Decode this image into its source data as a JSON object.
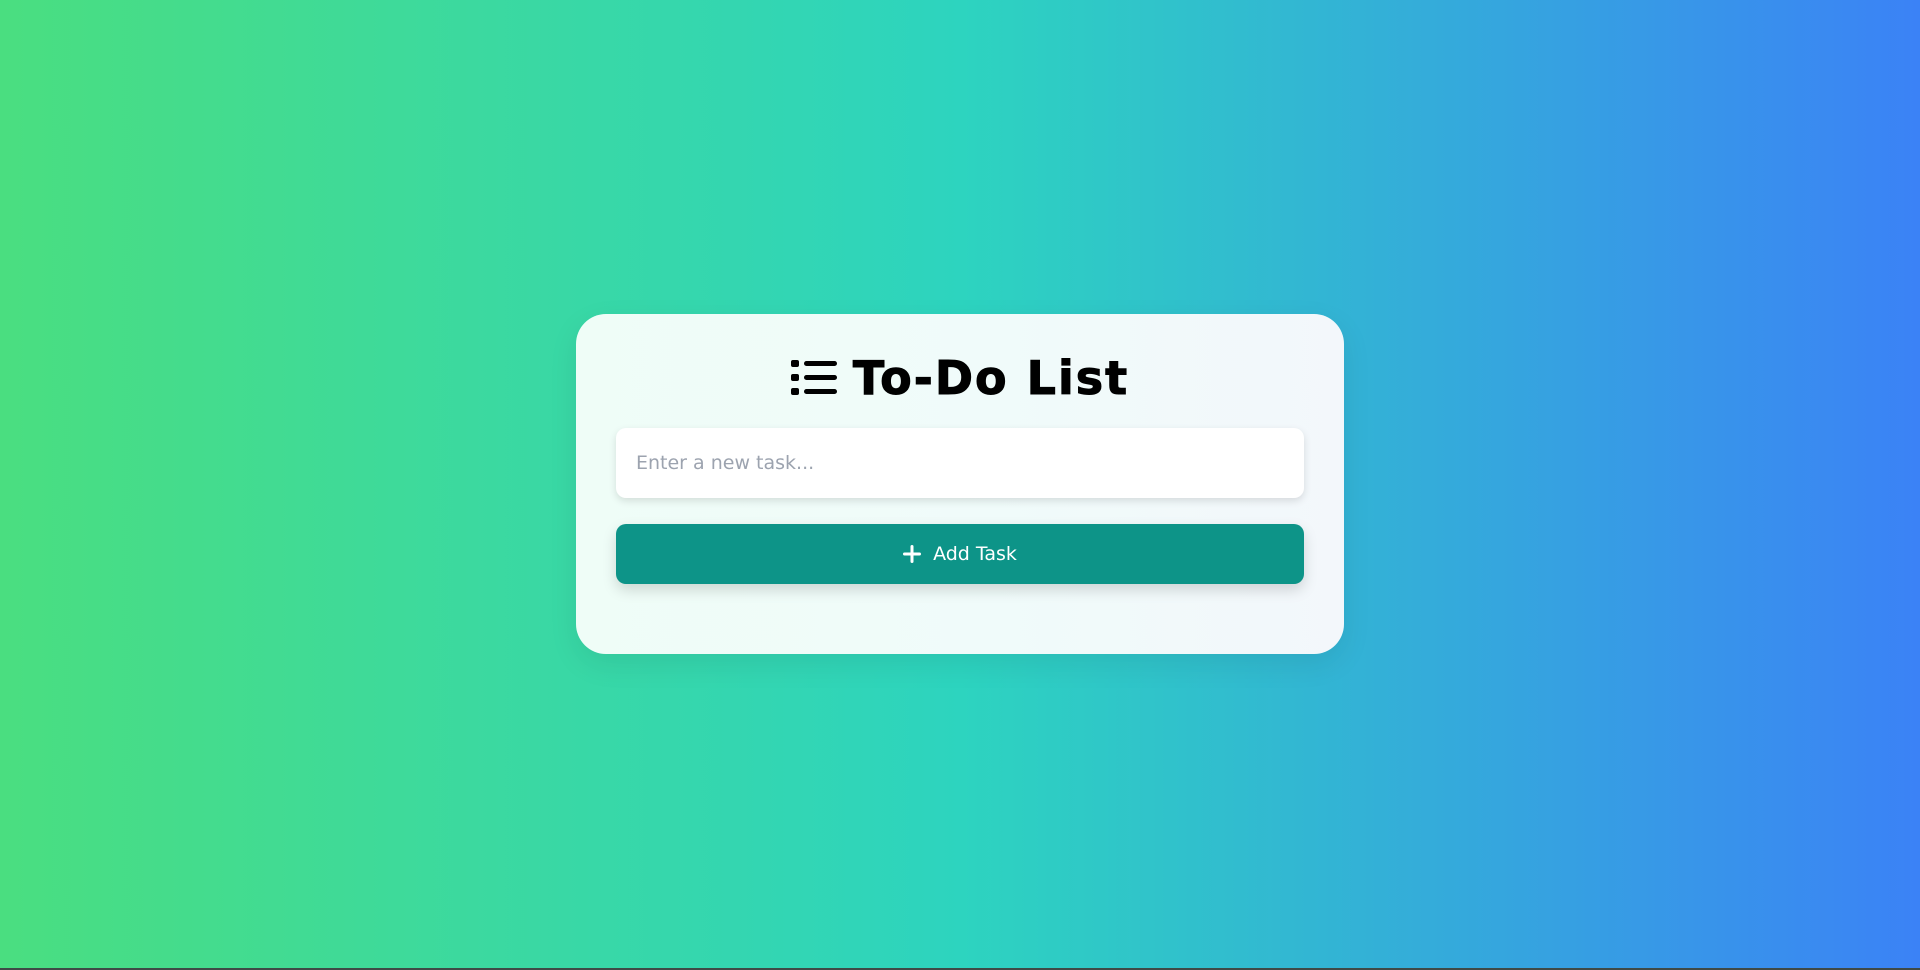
{
  "app": {
    "title": "To-Do List",
    "title_icon": "list-icon"
  },
  "input": {
    "placeholder": "Enter a new task...",
    "value": ""
  },
  "add_button": {
    "label": "Add Task",
    "icon": "plus-icon"
  },
  "tasks": [],
  "colors": {
    "background_gradient": [
      "#4ade80",
      "#2dd4bf",
      "#3b82f6"
    ],
    "button": "#0d9488",
    "card": "#f0fbfa",
    "title": "#000000"
  }
}
